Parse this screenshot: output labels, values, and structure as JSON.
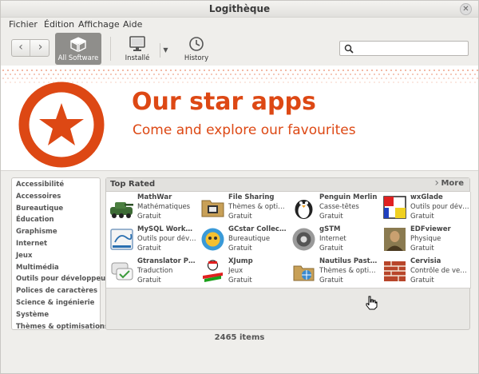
{
  "window": {
    "title": "Logithèque"
  },
  "menu": [
    "Fichier",
    "Édition",
    "Affichage",
    "Aide"
  ],
  "toolbar": {
    "back_icon": "chevron-left-icon",
    "forward_icon": "chevron-right-icon",
    "all_software": "All Software",
    "installed": "Installé",
    "history": "History",
    "search_placeholder": ""
  },
  "banner": {
    "title": "Our star apps",
    "subtitle": "Come and explore our favourites",
    "accent_color": "#dd4814"
  },
  "categories": [
    "Accessibilité",
    "Accessoires",
    "Bureautique",
    "Éducation",
    "Graphisme",
    "Internet",
    "Jeux",
    "Multimédia",
    "Outils pour développeurs",
    "Polices de caractères",
    "Science & ingénierie",
    "Système",
    "Thèmes & optimisations"
  ],
  "toprated": {
    "title": "Top Rated",
    "more": "More",
    "apps": [
      {
        "name": "MathWar",
        "category": "Mathématiques",
        "price": "Gratuit",
        "icon": "mathwar-icon"
      },
      {
        "name": "File Sharing",
        "category": "Thèmes & optimis…",
        "price": "Gratuit",
        "icon": "file-sharing-icon"
      },
      {
        "name": "Penguin Merlin",
        "category": "Casse-têtes",
        "price": "Gratuit",
        "icon": "penguin-icon"
      },
      {
        "name": "wxGlade",
        "category": "Outils pour dével…",
        "price": "Gratuit",
        "icon": "wxglade-icon"
      },
      {
        "name": "MySQL Workben…",
        "category": "Outils pour dével…",
        "price": "Gratuit",
        "icon": "mysql-workbench-icon"
      },
      {
        "name": "GCstar Collecti…",
        "category": "Bureautique",
        "price": "Gratuit",
        "icon": "gcstar-icon"
      },
      {
        "name": "gSTM",
        "category": "Internet",
        "price": "Gratuit",
        "icon": "gstm-icon"
      },
      {
        "name": "EDFviewer",
        "category": "Physique",
        "price": "Gratuit",
        "icon": "edfviewer-icon"
      },
      {
        "name": "Gtranslator PO …",
        "category": "Traduction",
        "price": "Gratuit",
        "icon": "gtranslator-icon"
      },
      {
        "name": "XJump",
        "category": "Jeux",
        "price": "Gratuit",
        "icon": "xjump-icon"
      },
      {
        "name": "Nautilus Pasteb…",
        "category": "Thèmes & optimi…",
        "price": "Gratuit",
        "icon": "nautilus-pastebin-icon"
      },
      {
        "name": "Cervisia",
        "category": "Contrôle de version",
        "price": "Gratuit",
        "icon": "cervisia-icon"
      }
    ]
  },
  "footer": {
    "count": "2465 items"
  }
}
